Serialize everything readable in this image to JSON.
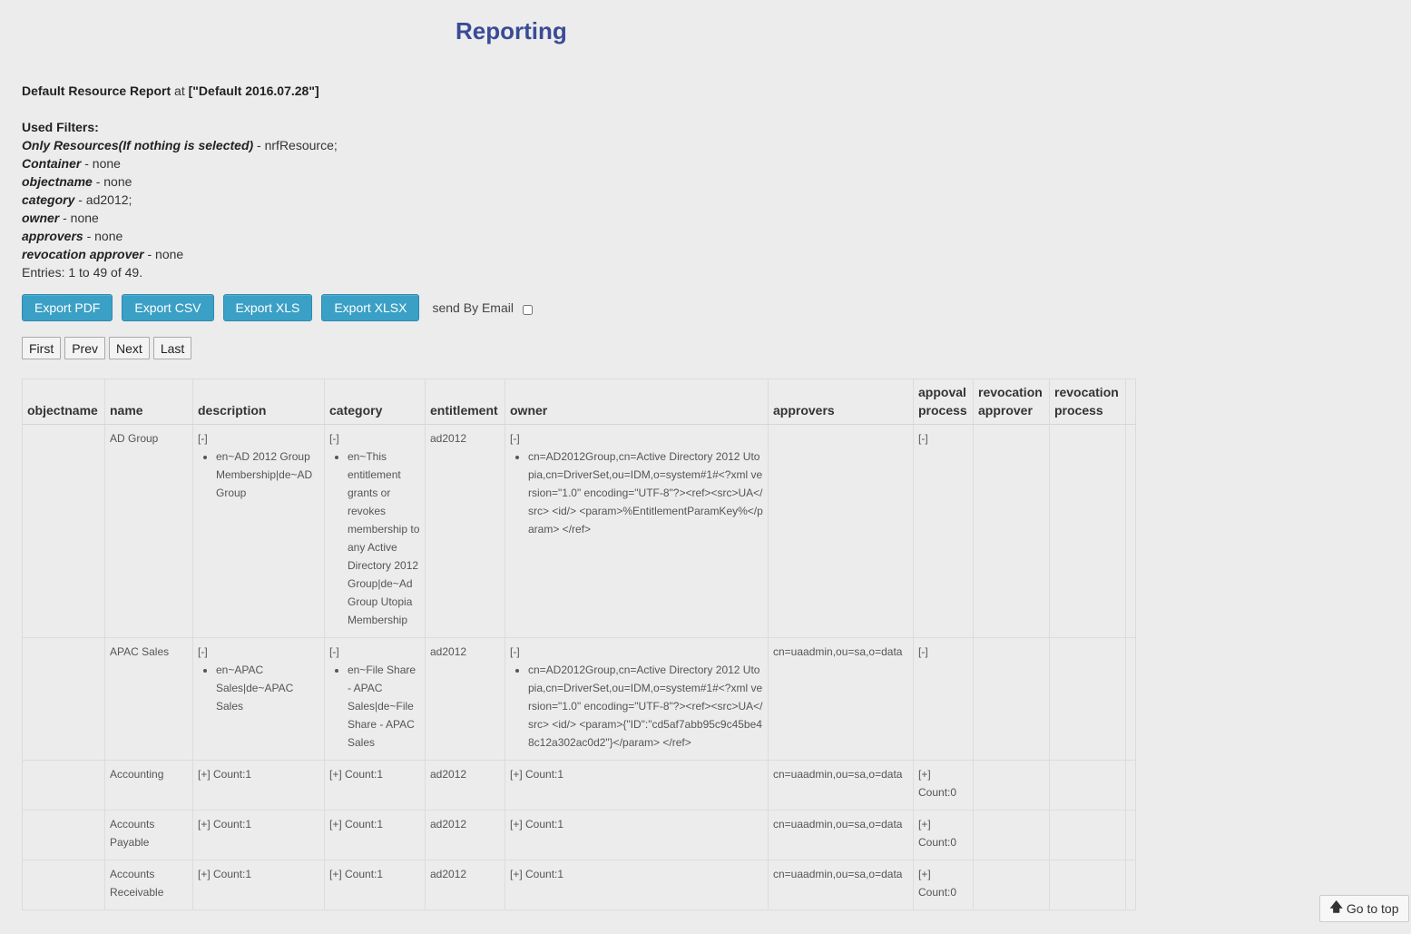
{
  "page": {
    "title": "Reporting"
  },
  "report": {
    "name": "Default Resource Report",
    "at_word": "at",
    "at_value": "[\"Default 2016.07.28\"]"
  },
  "filters": {
    "heading": "Used Filters:",
    "items": [
      {
        "label": "Only Resources(If nothing is selected)",
        "value": " - nrfResource;"
      },
      {
        "label": "Container",
        "value": " - none"
      },
      {
        "label": "objectname",
        "value": " - none"
      },
      {
        "label": "category",
        "value": " - ad2012;"
      },
      {
        "label": "owner",
        "value": " - none"
      },
      {
        "label": "approvers",
        "value": " - none"
      },
      {
        "label": "revocation approver",
        "value": " - none"
      }
    ],
    "entries": "Entries: 1 to 49 of 49."
  },
  "toolbar": {
    "export_pdf": "Export PDF",
    "export_csv": "Export CSV",
    "export_xls": "Export XLS",
    "export_xlsx": "Export XLSX",
    "send_by_email": "send By Email",
    "send_by_email_checked": false
  },
  "pager": {
    "first": "First",
    "prev": "Prev",
    "next": "Next",
    "last": "Last"
  },
  "table": {
    "headers": {
      "objectname": "objectname",
      "name": "name",
      "description": "description",
      "category": "category",
      "entitlement": "entitlement",
      "owner": "owner",
      "approvers": "approvers",
      "approval_1": "appoval",
      "approval_2": "process",
      "rev_approver_1": "revocation",
      "rev_approver_2": "approver",
      "rev_process_1": "revocation",
      "rev_process_2": "process"
    },
    "rows": [
      {
        "objectname": "",
        "name": "AD Group",
        "description_toggle": "[-]",
        "description_item": "en~AD 2012 Group Membership|de~AD Group",
        "category_toggle": "[-]",
        "category_item": "en~This entitlement grants or revokes membership to any Active Directory 2012 Group|de~Ad Group Utopia Membership",
        "entitlement": "ad2012",
        "owner_toggle": "[-]",
        "owner_item": "cn=AD2012Group,cn=Active Directory 2012 Utopia,cn=DriverSet,ou=IDM,o=system#1#<?xml version=\"1.0\" encoding=\"UTF-8\"?><ref><src>UA</src> <id/> <param>%EntitlementParamKey%</param> </ref>",
        "approvers": "",
        "approval": "[-]",
        "approval_count": "",
        "rev_approver": "",
        "rev_process": ""
      },
      {
        "objectname": "",
        "name": "APAC Sales",
        "description_toggle": "[-]",
        "description_item": "en~APAC Sales|de~APAC Sales",
        "category_toggle": "[-]",
        "category_item": "en~File Share - APAC Sales|de~File Share - APAC Sales",
        "entitlement": "ad2012",
        "owner_toggle": "[-]",
        "owner_item": "cn=AD2012Group,cn=Active Directory 2012 Utopia,cn=DriverSet,ou=IDM,o=system#1#<?xml version=\"1.0\" encoding=\"UTF-8\"?><ref><src>UA</src> <id/> <param>{\"ID\":\"cd5af7abb95c9c45be48c12a302ac0d2\"}</param> </ref>",
        "approvers": "cn=uaadmin,ou=sa,o=data",
        "approval": "[-]",
        "approval_count": "",
        "rev_approver": "",
        "rev_process": ""
      },
      {
        "objectname": "",
        "name": "Accounting",
        "description_toggle": "[+] Count:1",
        "description_item": "",
        "category_toggle": "[+] Count:1",
        "category_item": "",
        "entitlement": "ad2012",
        "owner_toggle": "[+] Count:1",
        "owner_item": "",
        "approvers": "cn=uaadmin,ou=sa,o=data",
        "approval": "[+]",
        "approval_count": "Count:0",
        "rev_approver": "",
        "rev_process": ""
      },
      {
        "objectname": "",
        "name": "Accounts Payable",
        "description_toggle": "[+] Count:1",
        "description_item": "",
        "category_toggle": "[+] Count:1",
        "category_item": "",
        "entitlement": "ad2012",
        "owner_toggle": "[+] Count:1",
        "owner_item": "",
        "approvers": "cn=uaadmin,ou=sa,o=data",
        "approval": "[+]",
        "approval_count": "Count:0",
        "rev_approver": "",
        "rev_process": ""
      },
      {
        "objectname": "",
        "name": "Accounts Receivable",
        "description_toggle": "[+] Count:1",
        "description_item": "",
        "category_toggle": "[+] Count:1",
        "category_item": "",
        "entitlement": "ad2012",
        "owner_toggle": "[+] Count:1",
        "owner_item": "",
        "approvers": "cn=uaadmin,ou=sa,o=data",
        "approval": "[+]",
        "approval_count": "Count:0",
        "rev_approver": "",
        "rev_process": ""
      }
    ]
  },
  "go_top": {
    "label": "Go to top",
    "icon": "arrow-up-icon"
  }
}
